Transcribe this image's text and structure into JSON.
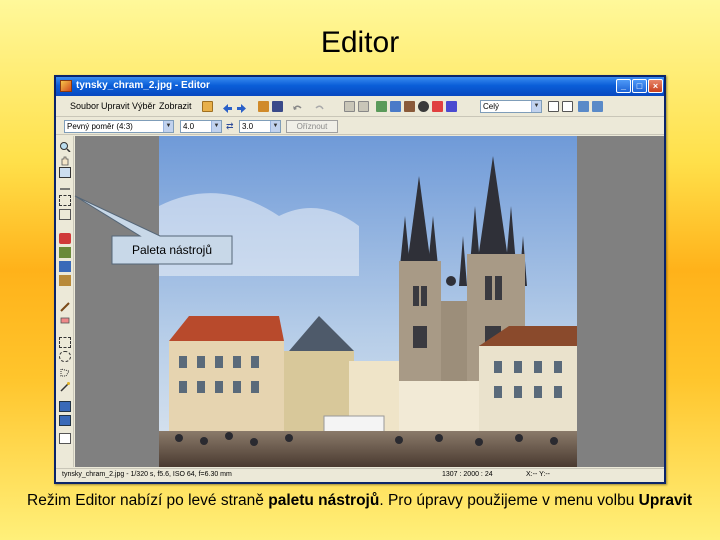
{
  "slide": {
    "title": "Editor",
    "caption_part1": "Režim Editor nabízí po levé straně ",
    "caption_bold1": "paletu nástrojů",
    "caption_part2": ". Pro úpravy použijeme v menu volbu ",
    "caption_bold2": "Upravit"
  },
  "window": {
    "title": "tynsky_chram_2.jpg - Editor",
    "minimize": "_",
    "maximize": "□",
    "close": "×"
  },
  "menu": {
    "soubor": "Soubor",
    "upravit": "Upravit",
    "vyber": "Výběr",
    "zobrazit": "Zobrazit"
  },
  "toolbar": {
    "color_mode": "Celý",
    "aspect_preset": "Pevný poměr (4:3)",
    "width": "4.0",
    "height": "3.0",
    "swap": "⇄",
    "crop_button": "Oříznout"
  },
  "status": {
    "file_info": "tynsky_chram_2.jpg - 1/320 s, f5.6, ISO 64, f=6.30 mm",
    "dimensions": "1307 : 2000 : 24",
    "cursor": "X:-- Y:--"
  },
  "callout": {
    "label": "Paleta nástrojů"
  },
  "colors": {
    "title_bar": "#0a5ed8",
    "window_bg": "#ece9d8",
    "canvas_bg": "#808080",
    "callout_fill": "#c8d8e8"
  }
}
